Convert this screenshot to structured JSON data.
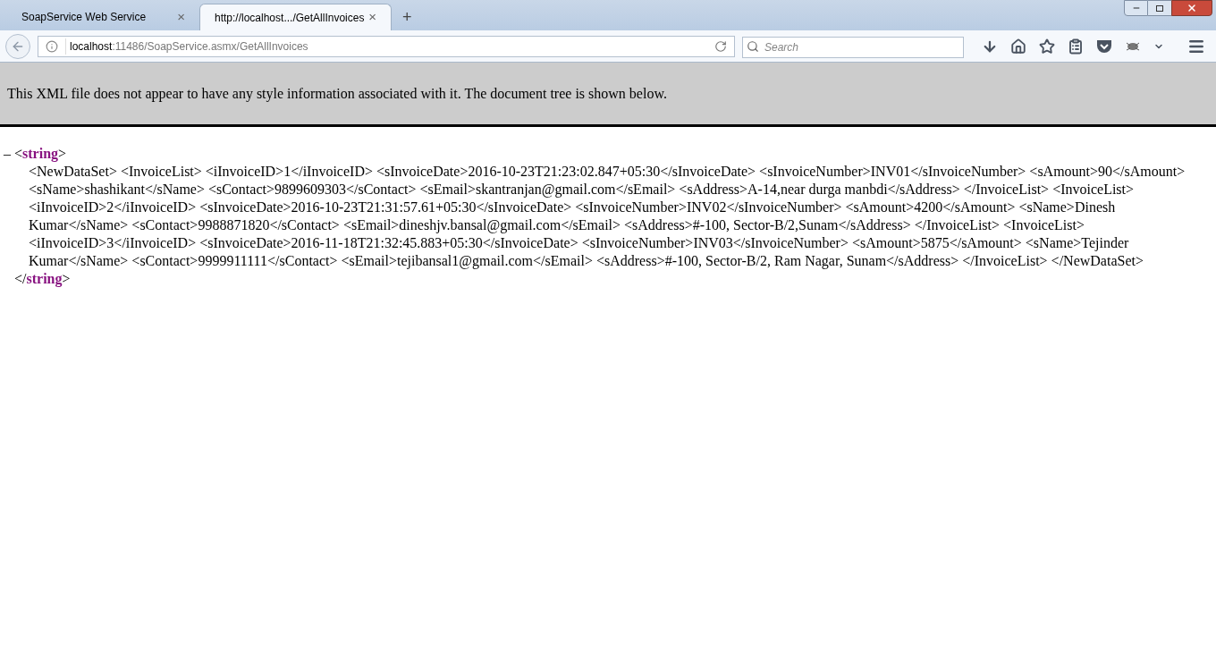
{
  "tabs": [
    {
      "title": "SoapService Web Service",
      "close": "×",
      "selected": false
    },
    {
      "title": "http://localhost.../GetAllInvoices",
      "close": "×",
      "selected": true
    }
  ],
  "new_tab": "+",
  "address_bar": {
    "host": "localhost",
    "path": ":11486/SoapService.asmx/GetAllInvoices"
  },
  "search": {
    "placeholder": "Search"
  },
  "xml_notice": "This XML file does not appear to have any style information associated with it. The document tree is shown below.",
  "xml_tree": {
    "toggle": "–",
    "expanded": true,
    "open_tag": {
      "start": "<",
      "name": "string",
      "end": ">"
    },
    "content": "<NewDataSet> <InvoiceList> <iInvoiceID>1</iInvoiceID> <sInvoiceDate>2016-10-23T21:23:02.847+05:30</sInvoiceDate> <sInvoiceNumber>INV01</sInvoiceNumber> <sAmount>90</sAmount> <sName>shashikant</sName> <sContact>9899609303</sContact> <sEmail>skantranjan@gmail.com</sEmail> <sAddress>A-14,near durga manbdi</sAddress> </InvoiceList> <InvoiceList> <iInvoiceID>2</iInvoiceID> <sInvoiceDate>2016-10-23T21:31:57.61+05:30</sInvoiceDate> <sInvoiceNumber>INV02</sInvoiceNumber> <sAmount>4200</sAmount> <sName>Dinesh Kumar</sName> <sContact>9988871820</sContact> <sEmail>dineshjv.bansal@gmail.com</sEmail> <sAddress>#-100, Sector-B/2,Sunam</sAddress> </InvoiceList> <InvoiceList> <iInvoiceID>3</iInvoiceID> <sInvoiceDate>2016-11-18T21:32:45.883+05:30</sInvoiceDate> <sInvoiceNumber>INV03</sInvoiceNumber> <sAmount>5875</sAmount> <sName>Tejinder Kumar</sName> <sContact>9999911111</sContact> <sEmail>tejibansal1@gmail.com</sEmail> <sAddress>#-100, Sector-B/2, Ram Nagar, Sunam</sAddress> </InvoiceList> </NewDataSet>",
    "close_tag": {
      "start": "</",
      "name": "string",
      "end": ">"
    }
  }
}
